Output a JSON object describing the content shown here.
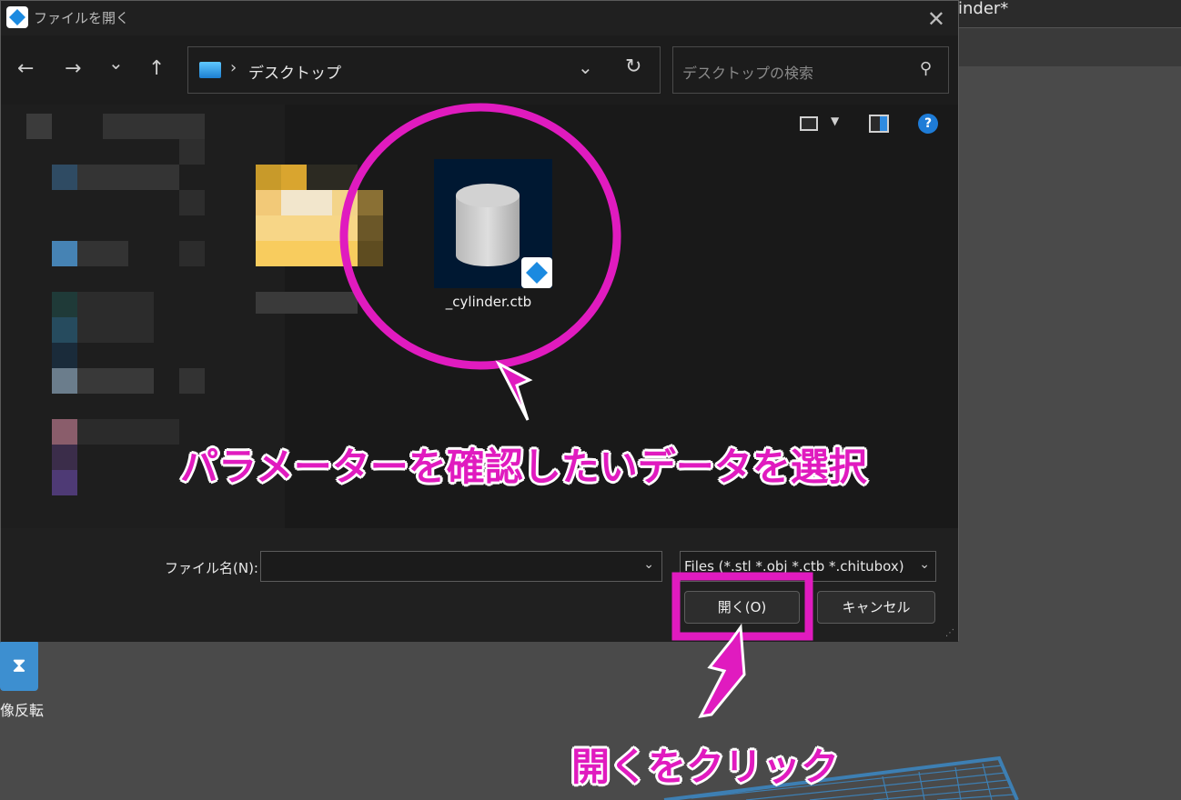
{
  "background_app": {
    "window_title_fragment": "inder*",
    "mirror_label": "像反転"
  },
  "dialog": {
    "title": "ファイルを開く",
    "nav": {
      "back": "←",
      "forward": "→",
      "recent": "⌄",
      "up": "↑"
    },
    "address": {
      "separator": "›",
      "location": "デスクトップ",
      "dropdown": "⌄",
      "refresh": "↻"
    },
    "search": {
      "placeholder": "デスクトップの検索",
      "icon": "⚲"
    },
    "help": "?",
    "file": {
      "name": "_cylinder.ctb"
    },
    "filename_label": "ファイル名(N):",
    "filename_value": "",
    "filter_value": "Files (*.stl *.obj *.ctb *.chitubox)",
    "open_button": "開く(O)",
    "cancel_button": "キャンセル"
  },
  "annotations": {
    "select_data": "パラメーターを確認したいデータを選択",
    "click_open": "開くをクリック",
    "color": "#e01bbf"
  }
}
